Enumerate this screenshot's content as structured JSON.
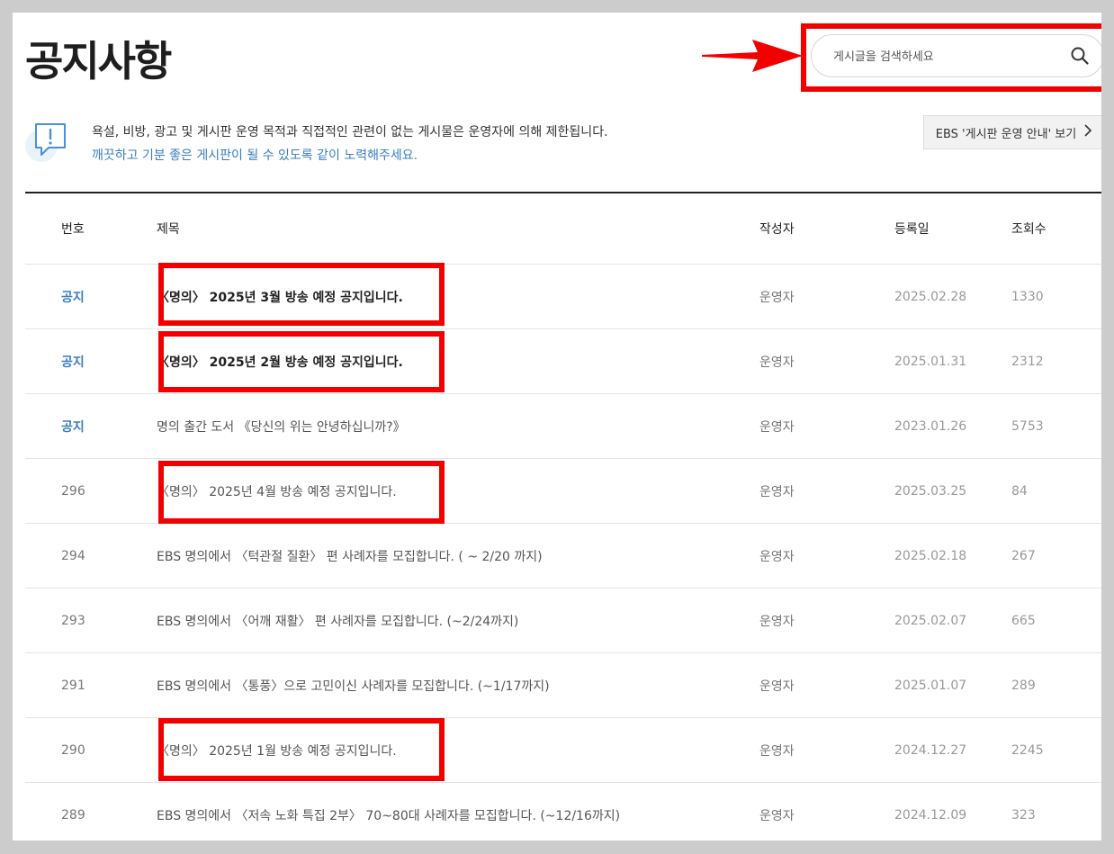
{
  "page": {
    "title": "공지사항"
  },
  "search": {
    "placeholder": "게시글을 검색하세요"
  },
  "notice": {
    "line1": "욕설, 비방, 광고 및 게시판 운영 목적과 직접적인 관련이 없는 게시물은 운영자에 의해 제한됩니다.",
    "line2": "깨끗하고 기분 좋은 게시판이 될 수 있도록 같이 노력해주세요."
  },
  "guide_button": {
    "label": "EBS '게시판 운영 안내' 보기"
  },
  "table": {
    "headers": {
      "num": "번호",
      "title": "제목",
      "author": "작성자",
      "date": "등록일",
      "views": "조회수"
    },
    "rows": [
      {
        "num": "공지",
        "title": "〈명의〉 2025년 3월 방송 예정 공지입니다.",
        "author": "운영자",
        "date": "2025.02.28",
        "views": "1330"
      },
      {
        "num": "공지",
        "title": "〈명의〉 2025년 2월 방송 예정 공지입니다.",
        "author": "운영자",
        "date": "2025.01.31",
        "views": "2312"
      },
      {
        "num": "공지",
        "title": "명의 출간 도서 《당신의 위는 안녕하십니까?》",
        "author": "운영자",
        "date": "2023.01.26",
        "views": "5753"
      },
      {
        "num": "296",
        "title": "〈명의〉 2025년 4월 방송 예정 공지입니다.",
        "author": "운영자",
        "date": "2025.03.25",
        "views": "84"
      },
      {
        "num": "294",
        "title": "EBS 명의에서 〈턱관절 질환〉 편 사례자를 모집합니다. ( ~ 2/20 까지)",
        "author": "운영자",
        "date": "2025.02.18",
        "views": "267"
      },
      {
        "num": "293",
        "title": "EBS 명의에서 〈어깨 재활〉 편 사례자를 모집합니다. (~2/24까지)",
        "author": "운영자",
        "date": "2025.02.07",
        "views": "665"
      },
      {
        "num": "291",
        "title": "EBS 명의에서 〈통풍〉으로 고민이신 사례자를 모집합니다. (~1/17까지)",
        "author": "운영자",
        "date": "2025.01.07",
        "views": "289"
      },
      {
        "num": "290",
        "title": "〈명의〉 2025년 1월 방송 예정 공지입니다.",
        "author": "운영자",
        "date": "2024.12.27",
        "views": "2245"
      },
      {
        "num": "289",
        "title": "EBS 명의에서 〈저속 노화 특집 2부〉 70~80대 사례자를 모집합니다. (~12/16까지)",
        "author": "운영자",
        "date": "2024.12.09",
        "views": "323"
      }
    ]
  },
  "colors": {
    "annotation": "#f20000",
    "accent": "#3a7ec0"
  }
}
